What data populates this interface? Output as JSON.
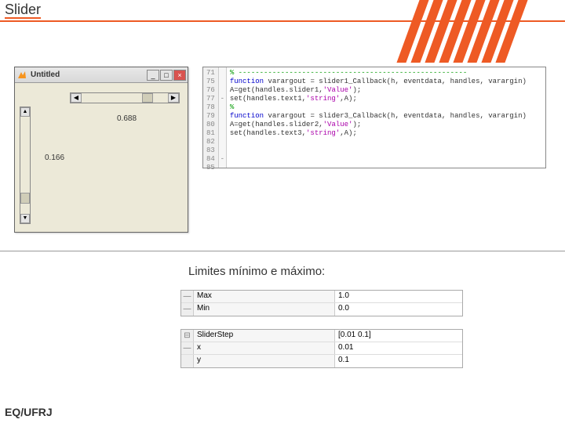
{
  "header": {
    "title": "Slider"
  },
  "window": {
    "title": "Untitled",
    "value_h": "0.688",
    "value_v": "0.166"
  },
  "code": {
    "lines": [
      71,
      75,
      76,
      77,
      78,
      79,
      80,
      81,
      82,
      83,
      84,
      85
    ],
    "marks": [
      "",
      "",
      "",
      "-",
      "",
      "",
      "",
      "",
      "",
      "",
      "-",
      ""
    ],
    "text": [
      {
        "t": "% ------------------------------------------------------",
        "c": "cm"
      },
      {
        "t": "function varargout = slider1_Callback(h, eventdata, handles, varargin)",
        "c": "kw"
      },
      {
        "t": "",
        "c": ""
      },
      {
        "t": "A=get(handles.slider1,'Value');",
        "c": ""
      },
      {
        "t": "set(handles.text1,'string',A);",
        "c": ""
      },
      {
        "t": "",
        "c": ""
      },
      {
        "t": "",
        "c": ""
      },
      {
        "t": "%",
        "c": "cm"
      },
      {
        "t": "function varargout = slider3_Callback(h, eventdata, handles, varargin)",
        "c": "kw"
      },
      {
        "t": "",
        "c": ""
      },
      {
        "t": "A=get(handles.slider2,'Value');",
        "c": ""
      },
      {
        "t": "set(handles.text3,'string',A);",
        "c": ""
      }
    ]
  },
  "limits_label": "Limites mínimo e máximo:",
  "props1": [
    {
      "exp": "—",
      "label": "Max",
      "value": "1.0"
    },
    {
      "exp": "—",
      "label": "Min",
      "value": "0.0"
    }
  ],
  "props2": [
    {
      "exp": "⊟",
      "label": "SliderStep",
      "value": "[0.01 0.1]"
    },
    {
      "exp": "—",
      "label": "x",
      "value": "0.01"
    },
    {
      "exp": "",
      "label": "y",
      "value": "0.1"
    }
  ],
  "footer": "EQ/UFRJ"
}
